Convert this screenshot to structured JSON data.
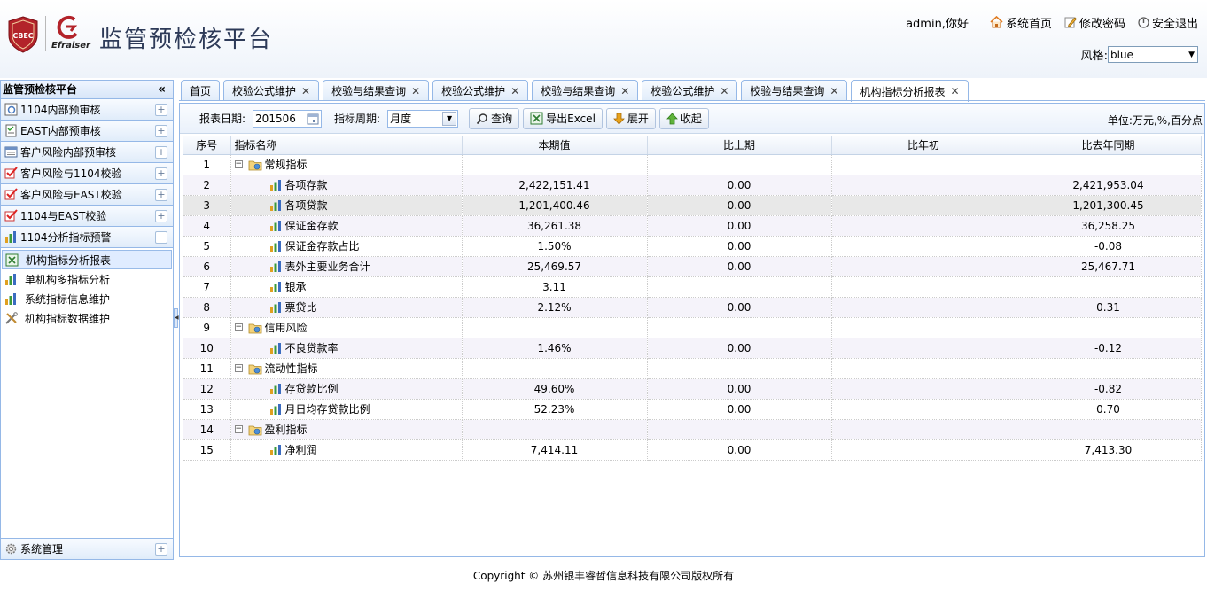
{
  "header": {
    "logo_text": "CBEC",
    "logo2_text": "Efraiser",
    "title": "监管预检核平台",
    "greeting": "admin,你好",
    "links": [
      "系统首页",
      "修改密码",
      "安全退出"
    ],
    "style_label": "风格:",
    "style_value": "blue"
  },
  "sidebar": {
    "title": "监管预检核平台",
    "collapse_glyph": "«",
    "groups": [
      {
        "label": "1104内部预审核",
        "tool": "+"
      },
      {
        "label": "EAST内部预审核",
        "tool": "+"
      },
      {
        "label": "客户风险内部预审核",
        "tool": "+"
      },
      {
        "label": "客户风险与1104校验",
        "tool": "+"
      },
      {
        "label": "客户风险与EAST校验",
        "tool": "+"
      },
      {
        "label": "1104与EAST校验",
        "tool": "+"
      },
      {
        "label": "1104分析指标预警",
        "tool": "−"
      }
    ],
    "items": [
      {
        "label": "机构指标分析报表"
      },
      {
        "label": "单机构多指标分析"
      },
      {
        "label": "系统指标信息维护"
      },
      {
        "label": "机构指标数据维护"
      }
    ],
    "bottom_group": {
      "label": "系统管理",
      "tool": "+"
    }
  },
  "tabs": [
    {
      "label": "首页",
      "closable": false
    },
    {
      "label": "校验公式维护",
      "closable": true
    },
    {
      "label": "校验与结果查询",
      "closable": true
    },
    {
      "label": "校验公式维护",
      "closable": true
    },
    {
      "label": "校验与结果查询",
      "closable": true
    },
    {
      "label": "校验公式维护",
      "closable": true
    },
    {
      "label": "校验与结果查询",
      "closable": true
    },
    {
      "label": "机构指标分析报表",
      "closable": true
    }
  ],
  "toolbar": {
    "date_label": "报表日期:",
    "date_value": "201506",
    "period_label": "指标周期:",
    "period_value": "月度",
    "query_label": "查询",
    "export_label": "导出Excel",
    "expand_label": "展开",
    "collapse_label": "收起",
    "unit_text": "单位:万元,%,百分点"
  },
  "grid": {
    "columns": [
      "序号",
      "指标名称",
      "本期值",
      "比上期",
      "比年初",
      "比去年同期"
    ],
    "rows": [
      {
        "no": "1",
        "name": "常规指标",
        "folder": true,
        "cur": "",
        "prev": "",
        "ytd": "",
        "yoy": ""
      },
      {
        "no": "2",
        "name": "各项存款",
        "folder": false,
        "cur": "2,422,151.41",
        "prev": "0.00",
        "ytd": "",
        "yoy": "2,421,953.04"
      },
      {
        "no": "3",
        "name": "各项贷款",
        "folder": false,
        "cur": "1,201,400.46",
        "prev": "0.00",
        "ytd": "",
        "yoy": "1,201,300.45"
      },
      {
        "no": "4",
        "name": "保证金存款",
        "folder": false,
        "cur": "36,261.38",
        "prev": "0.00",
        "ytd": "",
        "yoy": "36,258.25"
      },
      {
        "no": "5",
        "name": "保证金存款占比",
        "folder": false,
        "cur": "1.50%",
        "prev": "0.00",
        "ytd": "",
        "yoy": "-0.08"
      },
      {
        "no": "6",
        "name": "表外主要业务合计",
        "folder": false,
        "cur": "25,469.57",
        "prev": "0.00",
        "ytd": "",
        "yoy": "25,467.71"
      },
      {
        "no": "7",
        "name": "银承",
        "folder": false,
        "cur": "3.11",
        "prev": "",
        "ytd": "",
        "yoy": ""
      },
      {
        "no": "8",
        "name": "票贷比",
        "folder": false,
        "cur": "2.12%",
        "prev": "0.00",
        "ytd": "",
        "yoy": "0.31"
      },
      {
        "no": "9",
        "name": "信用风险",
        "folder": true,
        "cur": "",
        "prev": "",
        "ytd": "",
        "yoy": ""
      },
      {
        "no": "10",
        "name": "不良贷款率",
        "folder": false,
        "cur": "1.46%",
        "prev": "0.00",
        "ytd": "",
        "yoy": "-0.12"
      },
      {
        "no": "11",
        "name": "流动性指标",
        "folder": true,
        "cur": "",
        "prev": "",
        "ytd": "",
        "yoy": ""
      },
      {
        "no": "12",
        "name": "存贷款比例",
        "folder": false,
        "cur": "49.60%",
        "prev": "0.00",
        "ytd": "",
        "yoy": "-0.82"
      },
      {
        "no": "13",
        "name": "月日均存贷款比例",
        "folder": false,
        "cur": "52.23%",
        "prev": "0.00",
        "ytd": "",
        "yoy": "0.70"
      },
      {
        "no": "14",
        "name": "盈利指标",
        "folder": true,
        "cur": "",
        "prev": "",
        "ytd": "",
        "yoy": ""
      },
      {
        "no": "15",
        "name": "净利润",
        "folder": false,
        "cur": "7,414.11",
        "prev": "0.00",
        "ytd": "",
        "yoy": "7,413.30"
      }
    ]
  },
  "footer": {
    "copyright": "Copyright © 苏州银丰睿哲信息科技有限公司版权所有"
  },
  "colors": {
    "accent_border": "#95b8e7",
    "title_color": "#2d3a58",
    "logo_red": "#b3232a"
  }
}
